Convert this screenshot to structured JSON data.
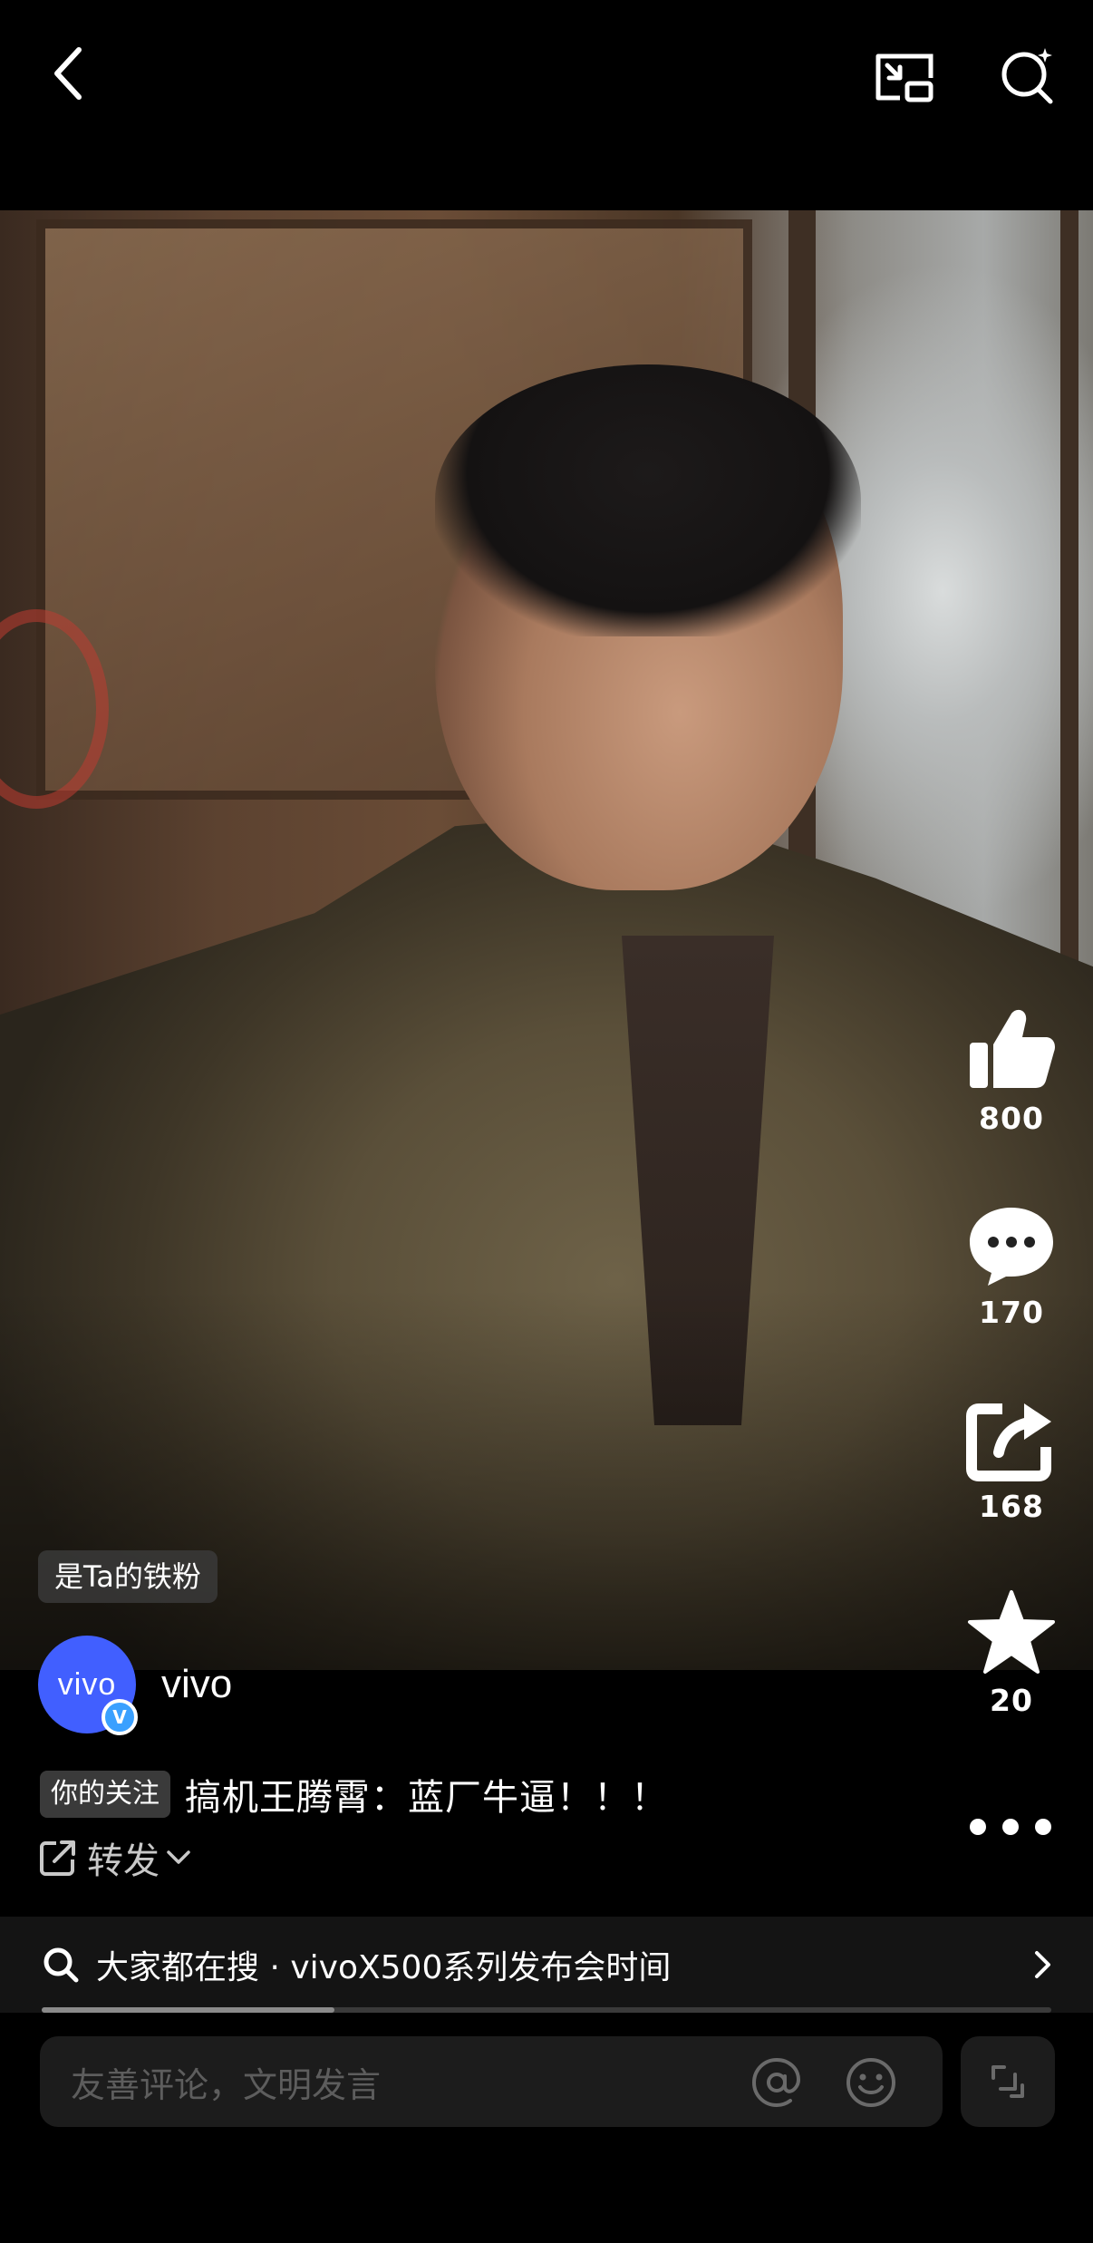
{
  "video": {
    "fan_badge": "是Ta的铁粉"
  },
  "actions": {
    "like_count": "800",
    "comment_count": "170",
    "share_count": "168",
    "favorite_count": "20"
  },
  "author": {
    "name": "vivo",
    "avatar_text": "vivo",
    "verified_mark": "V"
  },
  "post": {
    "follow_tag": "你的关注",
    "caption": "搞机王腾霄：蓝厂牛逼！！！",
    "repost_label": "转发"
  },
  "trending": {
    "text": "大家都在搜 · vivoX500系列发布会时间"
  },
  "playback": {
    "progress": 0.29
  },
  "comment_input": {
    "placeholder": "友善评论，文明发言"
  },
  "icons": {
    "back": "chevron-left-icon",
    "pip": "picture-in-picture-icon",
    "search": "search-icon",
    "like": "thumbs-up-icon",
    "comment": "speech-bubble-icon",
    "share": "share-icon",
    "favorite": "star-icon",
    "more": "more-dots-icon",
    "at": "at-icon",
    "emoji": "emoji-icon",
    "expand": "expand-icon"
  },
  "colors": {
    "background": "#000000",
    "avatar_bg": "#415fff",
    "verify_badge": "#3aa0ff",
    "input_bg": "#1c1c1c"
  }
}
